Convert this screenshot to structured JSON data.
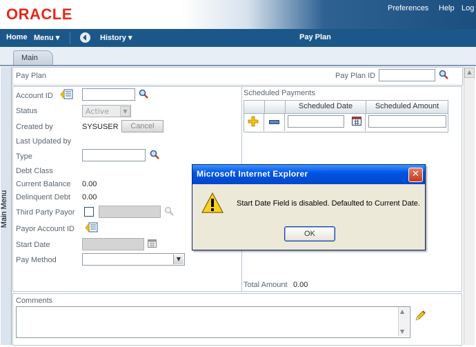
{
  "header": {
    "logo": "ORACLE",
    "links": [
      "Preferences",
      "Help",
      "Log"
    ]
  },
  "navbar": {
    "home": "Home",
    "menu": "Menu",
    "history": "History",
    "page_title": "Pay Plan"
  },
  "tabs": {
    "main": "Main"
  },
  "side_menu": {
    "label": "Main Menu"
  },
  "pay_plan": {
    "section_title": "Pay Plan",
    "id_label": "Pay Plan ID",
    "id_value": ""
  },
  "form": {
    "account_id_label": "Account ID",
    "status_label": "Status",
    "status_value": "Active",
    "created_by_label": "Created by",
    "created_by_value": "SYSUSER",
    "cancel_button": "Cancel",
    "last_updated_by_label": "Last Updated by",
    "type_label": "Type",
    "debt_class_label": "Debt Class",
    "current_balance_label": "Current Balance",
    "current_balance_value": "0.00",
    "delinquent_debt_label": "Delinquent Debt",
    "delinquent_debt_value": "0.00",
    "third_party_payor_label": "Third Party Payor",
    "payor_account_id_label": "Payor Account ID",
    "start_date_label": "Start Date",
    "pay_method_label": "Pay Method"
  },
  "scheduled_payments": {
    "title": "Scheduled Payments",
    "columns": [
      "Scheduled Date",
      "Scheduled Amount"
    ],
    "total_label": "Total Amount",
    "total_value": "0.00"
  },
  "comments": {
    "label": "Comments"
  },
  "dialog": {
    "title": "Microsoft Internet Explorer",
    "message": "Start Date Field is disabled. Defaulted to Current Date.",
    "ok_button": "OK"
  },
  "colors": {
    "brand_red": "#e6281b",
    "nav_blue": "#1b5889",
    "dialog_title_blue": "#0055e5"
  }
}
